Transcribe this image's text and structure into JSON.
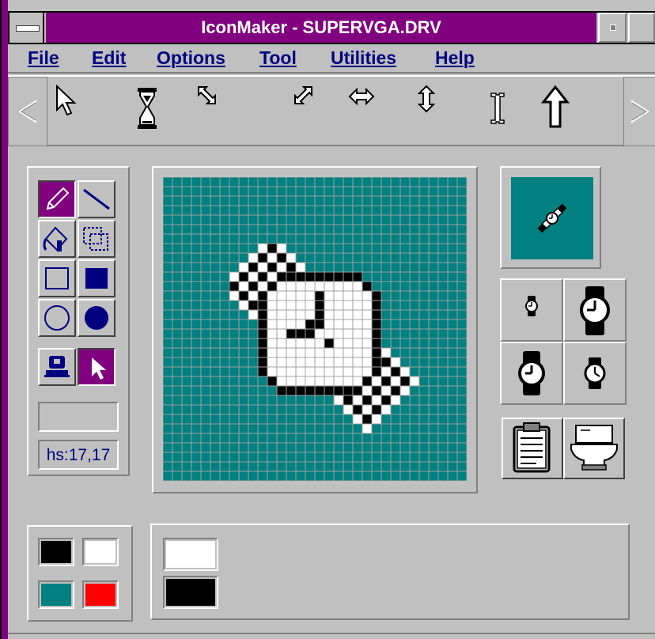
{
  "window": {
    "title": "IconMaker - SUPERVGA.DRV"
  },
  "menu": {
    "items": [
      {
        "label": "File"
      },
      {
        "label": "Edit"
      },
      {
        "label": "Options"
      },
      {
        "label": "Tool"
      },
      {
        "label": "Utilities"
      },
      {
        "label": "Help"
      }
    ]
  },
  "cursor_toolbar": {
    "left_scroll_icon": "left-triangle-icon",
    "right_scroll_icon": "right-triangle-icon",
    "cursors": [
      {
        "name": "arrow-cursor-icon"
      },
      {
        "name": "hourglass-cursor-icon"
      },
      {
        "name": "resize-nwse-cursor-icon"
      },
      {
        "name": "resize-nesw-cursor-icon"
      },
      {
        "name": "resize-horizontal-cursor-icon"
      },
      {
        "name": "resize-vertical-cursor-icon"
      },
      {
        "name": "ibeam-cursor-icon"
      },
      {
        "name": "up-arrow-cursor-icon"
      }
    ]
  },
  "tools": {
    "items": [
      {
        "name": "pencil-icon",
        "selected": true
      },
      {
        "name": "line-icon",
        "selected": false
      },
      {
        "name": "fill-bucket-icon",
        "selected": false
      },
      {
        "name": "select-rect-icon",
        "selected": false
      },
      {
        "name": "rect-outline-icon",
        "selected": false
      },
      {
        "name": "rect-filled-icon",
        "selected": false
      },
      {
        "name": "ellipse-outline-icon",
        "selected": false
      },
      {
        "name": "ellipse-filled-icon",
        "selected": false
      }
    ],
    "mode_buttons": [
      {
        "name": "stamp-icon",
        "selected": false
      },
      {
        "name": "hotspot-pointer-icon",
        "selected": true
      }
    ],
    "blank_field": "",
    "hotspot_text": "hs:17,17"
  },
  "editor": {
    "grid_cols": 32,
    "grid_rows": 32,
    "background_color": "#008080",
    "grid_line_color": "#a0a0a0"
  },
  "size_buttons": [
    {
      "name": "watch-small-icon"
    },
    {
      "name": "watch-large-icon"
    },
    {
      "name": "watch-medium-icon"
    },
    {
      "name": "watch-round-icon"
    }
  ],
  "action_buttons": [
    {
      "name": "clipboard-icon"
    },
    {
      "name": "toilet-trash-icon"
    }
  ],
  "colors": {
    "palette": [
      "#000000",
      "#ffffff",
      "#008080",
      "#ff0000"
    ],
    "selected": [
      "#ffffff",
      "#000000"
    ],
    "accent": "#800080"
  }
}
